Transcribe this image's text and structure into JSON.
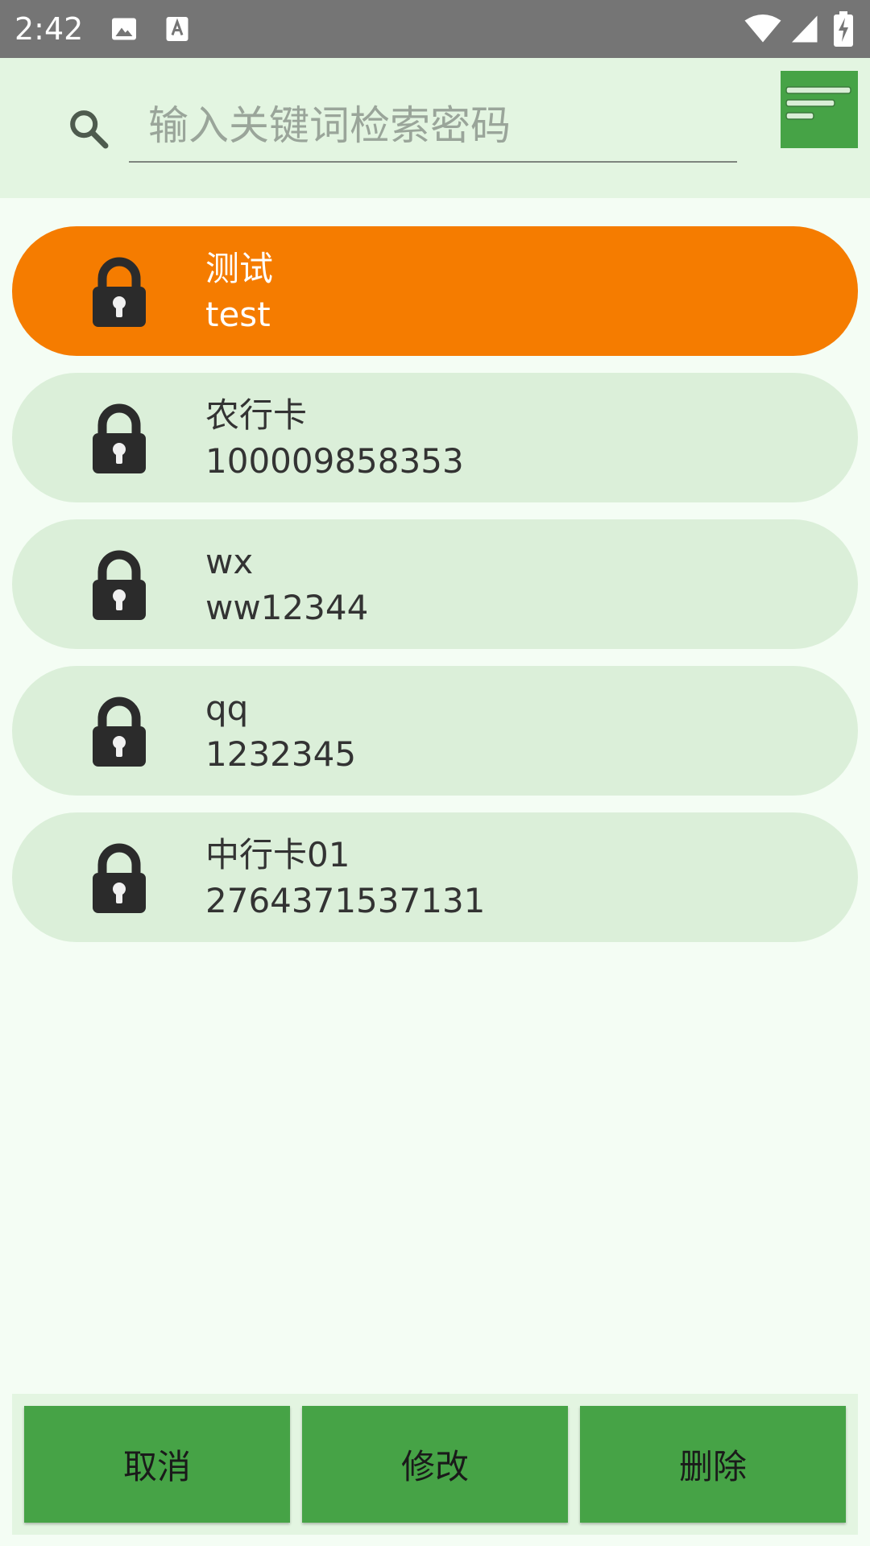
{
  "status_bar": {
    "time": "2:42",
    "icons": [
      "image-icon",
      "text-notification-icon",
      "wifi-icon",
      "cellular-signal-icon",
      "battery-charging-icon"
    ]
  },
  "search": {
    "placeholder": "输入关键词检索密码",
    "value": "",
    "icon": "search-icon"
  },
  "menu": {
    "icon": "list-menu-icon"
  },
  "entries": [
    {
      "title": "测试",
      "value": "test",
      "selected": true
    },
    {
      "title": "农行卡",
      "value": "100009858353",
      "selected": false
    },
    {
      "title": "wx",
      "value": "ww12344",
      "selected": false
    },
    {
      "title": "qq",
      "value": "1232345",
      "selected": false
    },
    {
      "title": "中行卡01",
      "value": "2764371537131",
      "selected": false
    }
  ],
  "actions": {
    "cancel_label": "取消",
    "edit_label": "修改",
    "delete_label": "删除"
  },
  "colors": {
    "accent_green": "#46a346",
    "selected_orange": "#f57c00",
    "item_background": "#dbefd9",
    "header_background": "#e3f5e1",
    "page_background": "#f4fdf4",
    "status_bar": "#757575"
  }
}
